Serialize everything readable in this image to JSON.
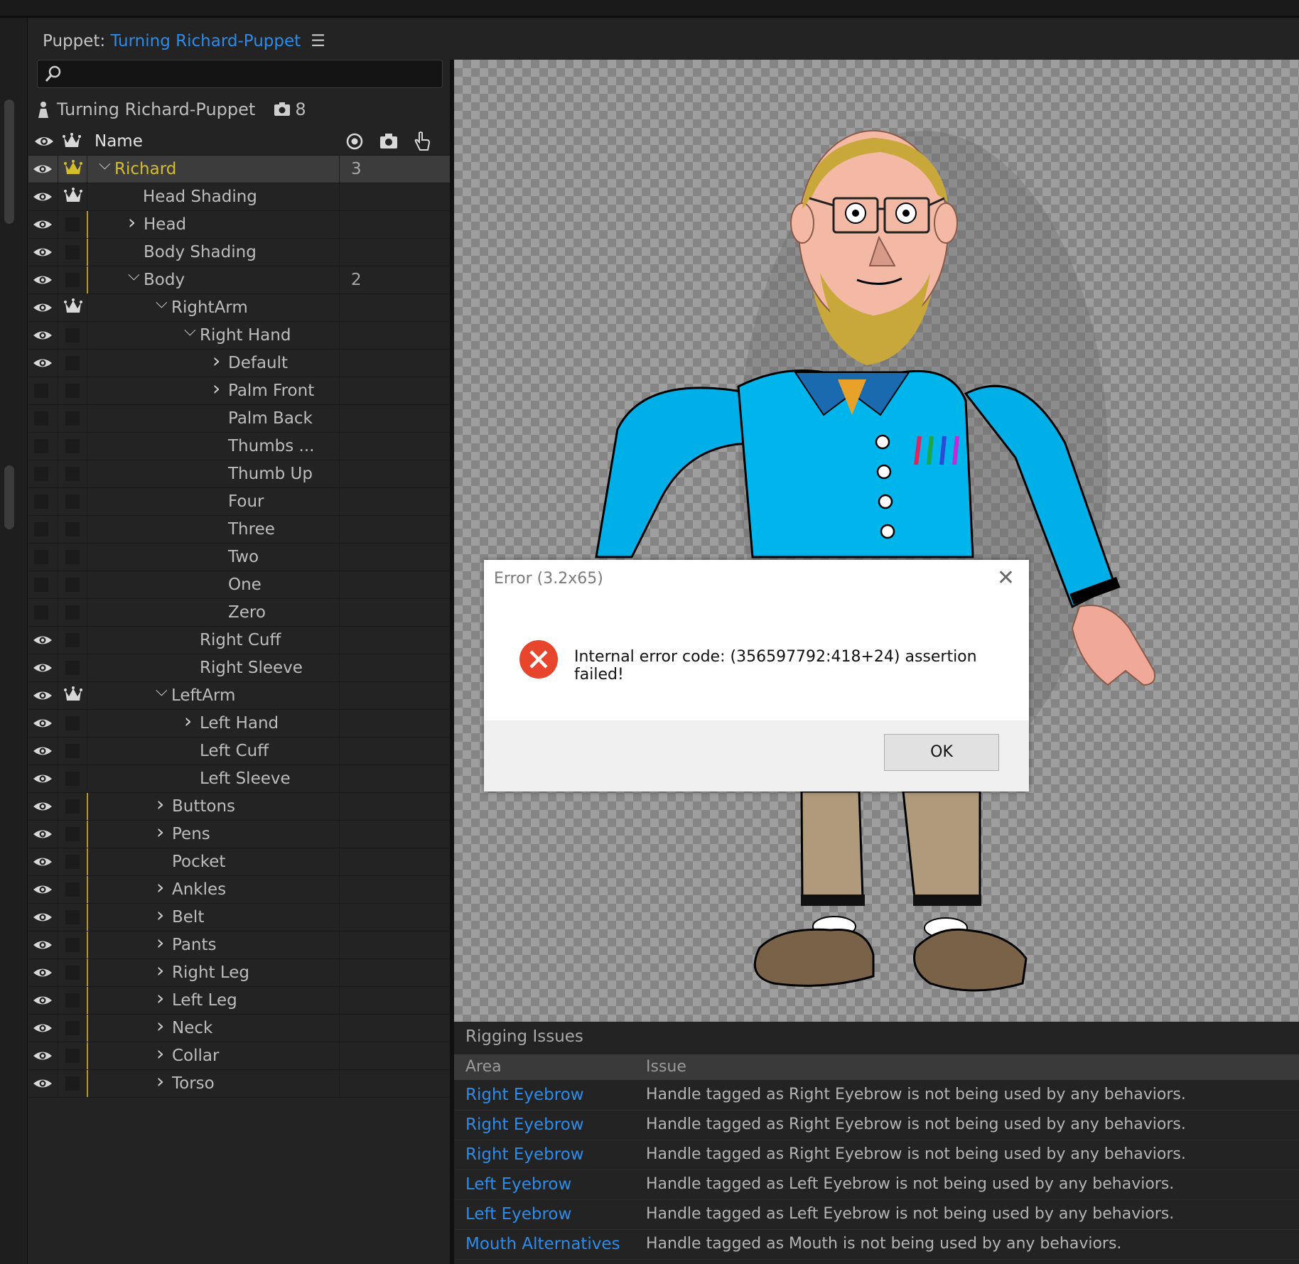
{
  "panel": {
    "prefix": "Puppet: ",
    "puppet_name": "Turning Richard-Puppet",
    "menu_icon": "hamburger-menu-icon",
    "search_placeholder": "",
    "root_name": "Turning Richard-Puppet",
    "camera_count": "8"
  },
  "tree_header": {
    "name": "Name"
  },
  "tree_rows": [
    {
      "name": "Richard",
      "indent": 0,
      "arrow": "down",
      "val": "3",
      "eye": true,
      "crown": true,
      "sel": true,
      "ybar": false
    },
    {
      "name": "Head Shading",
      "indent": 1,
      "arrow": "",
      "val": "",
      "eye": true,
      "crown": true,
      "sel": false,
      "ybar": false
    },
    {
      "name": "Head",
      "indent": 1,
      "arrow": "right",
      "val": "",
      "eye": true,
      "crown": false,
      "sel": false,
      "ybar": true
    },
    {
      "name": "Body Shading",
      "indent": 1,
      "arrow": "",
      "val": "",
      "eye": true,
      "crown": false,
      "sel": false,
      "ybar": true
    },
    {
      "name": "Body",
      "indent": 1,
      "arrow": "down",
      "val": "2",
      "eye": true,
      "crown": false,
      "sel": false,
      "ybar": true
    },
    {
      "name": "RightArm",
      "indent": 2,
      "arrow": "down",
      "val": "",
      "eye": true,
      "crown": true,
      "sel": false,
      "ybar": false
    },
    {
      "name": "Right Hand",
      "indent": 3,
      "arrow": "down",
      "val": "",
      "eye": true,
      "crown": false,
      "sel": false,
      "ybar": false
    },
    {
      "name": "Default",
      "indent": 4,
      "arrow": "right",
      "val": "",
      "eye": true,
      "crown": false,
      "sel": false,
      "ybar": false
    },
    {
      "name": "Palm Front",
      "indent": 4,
      "arrow": "right",
      "val": "",
      "eye": false,
      "crown": false,
      "sel": false,
      "ybar": false
    },
    {
      "name": "Palm Back",
      "indent": 4,
      "arrow": "",
      "val": "",
      "eye": false,
      "crown": false,
      "sel": false,
      "ybar": false
    },
    {
      "name": "Thumbs ...",
      "indent": 4,
      "arrow": "",
      "val": "",
      "eye": false,
      "crown": false,
      "sel": false,
      "ybar": false
    },
    {
      "name": "Thumb Up",
      "indent": 4,
      "arrow": "",
      "val": "",
      "eye": false,
      "crown": false,
      "sel": false,
      "ybar": false
    },
    {
      "name": "Four",
      "indent": 4,
      "arrow": "",
      "val": "",
      "eye": false,
      "crown": false,
      "sel": false,
      "ybar": false
    },
    {
      "name": "Three",
      "indent": 4,
      "arrow": "",
      "val": "",
      "eye": false,
      "crown": false,
      "sel": false,
      "ybar": false
    },
    {
      "name": "Two",
      "indent": 4,
      "arrow": "",
      "val": "",
      "eye": false,
      "crown": false,
      "sel": false,
      "ybar": false
    },
    {
      "name": "One",
      "indent": 4,
      "arrow": "",
      "val": "",
      "eye": false,
      "crown": false,
      "sel": false,
      "ybar": false
    },
    {
      "name": "Zero",
      "indent": 4,
      "arrow": "",
      "val": "",
      "eye": false,
      "crown": false,
      "sel": false,
      "ybar": false
    },
    {
      "name": "Right Cuff",
      "indent": 3,
      "arrow": "",
      "val": "",
      "eye": true,
      "crown": false,
      "sel": false,
      "ybar": false
    },
    {
      "name": "Right Sleeve",
      "indent": 3,
      "arrow": "",
      "val": "",
      "eye": true,
      "crown": false,
      "sel": false,
      "ybar": false
    },
    {
      "name": "LeftArm",
      "indent": 2,
      "arrow": "down",
      "val": "",
      "eye": true,
      "crown": true,
      "sel": false,
      "ybar": false
    },
    {
      "name": "Left Hand",
      "indent": 3,
      "arrow": "right",
      "val": "",
      "eye": true,
      "crown": false,
      "sel": false,
      "ybar": false
    },
    {
      "name": "Left Cuff",
      "indent": 3,
      "arrow": "",
      "val": "",
      "eye": true,
      "crown": false,
      "sel": false,
      "ybar": false
    },
    {
      "name": "Left Sleeve",
      "indent": 3,
      "arrow": "",
      "val": "",
      "eye": true,
      "crown": false,
      "sel": false,
      "ybar": false
    },
    {
      "name": "Buttons",
      "indent": 2,
      "arrow": "right",
      "val": "",
      "eye": true,
      "crown": false,
      "sel": false,
      "ybar": true
    },
    {
      "name": "Pens",
      "indent": 2,
      "arrow": "right",
      "val": "",
      "eye": true,
      "crown": false,
      "sel": false,
      "ybar": true
    },
    {
      "name": "Pocket",
      "indent": 2,
      "arrow": "",
      "val": "",
      "eye": true,
      "crown": false,
      "sel": false,
      "ybar": true
    },
    {
      "name": "Ankles",
      "indent": 2,
      "arrow": "right",
      "val": "",
      "eye": true,
      "crown": false,
      "sel": false,
      "ybar": true
    },
    {
      "name": "Belt",
      "indent": 2,
      "arrow": "right",
      "val": "",
      "eye": true,
      "crown": false,
      "sel": false,
      "ybar": true
    },
    {
      "name": "Pants",
      "indent": 2,
      "arrow": "right",
      "val": "",
      "eye": true,
      "crown": false,
      "sel": false,
      "ybar": true
    },
    {
      "name": "Right Leg",
      "indent": 2,
      "arrow": "right",
      "val": "",
      "eye": true,
      "crown": false,
      "sel": false,
      "ybar": true
    },
    {
      "name": "Left Leg",
      "indent": 2,
      "arrow": "right",
      "val": "",
      "eye": true,
      "crown": false,
      "sel": false,
      "ybar": true
    },
    {
      "name": "Neck",
      "indent": 2,
      "arrow": "right",
      "val": "",
      "eye": true,
      "crown": false,
      "sel": false,
      "ybar": true
    },
    {
      "name": "Collar",
      "indent": 2,
      "arrow": "right",
      "val": "",
      "eye": true,
      "crown": false,
      "sel": false,
      "ybar": true
    },
    {
      "name": "Torso",
      "indent": 2,
      "arrow": "right",
      "val": "",
      "eye": true,
      "crown": false,
      "sel": false,
      "ybar": true
    }
  ],
  "dialog": {
    "title": "Error (3.2x65)",
    "message": "Internal error code: (356597792:418+24) assertion failed!",
    "ok_label": "OK",
    "close_icon": "close-icon",
    "error_icon": "error-icon"
  },
  "rigging": {
    "title": "Rigging Issues",
    "col_area": "Area",
    "col_issue": "Issue",
    "rows": [
      {
        "area": "Right Eyebrow",
        "issue": "Handle tagged as Right Eyebrow is not being used by any behaviors."
      },
      {
        "area": "Right Eyebrow",
        "issue": "Handle tagged as Right Eyebrow is not being used by any behaviors."
      },
      {
        "area": "Right Eyebrow",
        "issue": "Handle tagged as Right Eyebrow is not being used by any behaviors."
      },
      {
        "area": "Left Eyebrow",
        "issue": "Handle tagged as Left Eyebrow is not being used by any behaviors."
      },
      {
        "area": "Left Eyebrow",
        "issue": "Handle tagged as Left Eyebrow is not being used by any behaviors."
      },
      {
        "area": "Mouth Alternatives",
        "issue": "Handle tagged as Mouth is not being used by any behaviors."
      }
    ]
  },
  "colors": {
    "accent_blue": "#2d8ceb",
    "selected_yellow": "#d4bd2b",
    "shirt": "#00aee8",
    "pants": "#b09a7c",
    "error_red": "#e8462c"
  }
}
